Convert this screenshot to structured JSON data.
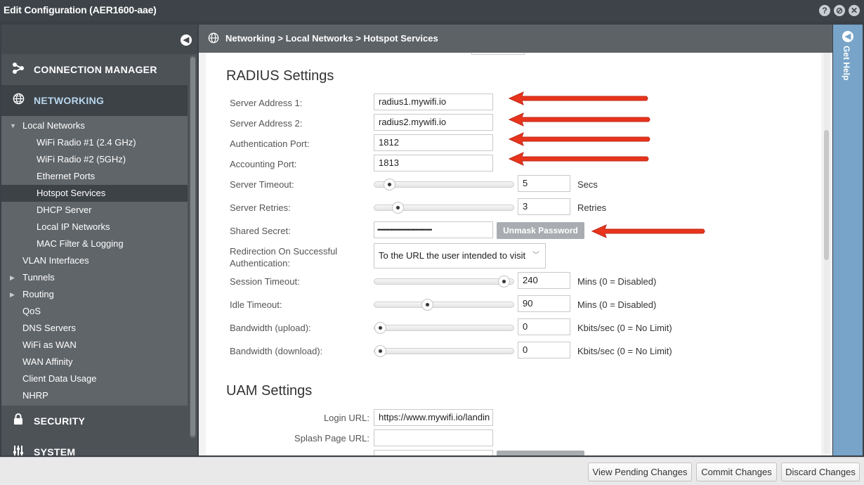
{
  "window": {
    "title": "Edit Configuration (AER1600-aae)",
    "buttons": [
      "?",
      "⊘",
      "✕"
    ]
  },
  "sidebar": {
    "collapse_icon": "chevron-left-icon",
    "sections": {
      "connection_manager": "CONNECTION MANAGER",
      "networking": "NETWORKING",
      "security": "SECURITY",
      "system": "SYSTEM"
    },
    "items": [
      {
        "label": "Local Networks",
        "level": 1,
        "caret": "▼"
      },
      {
        "label": "WiFi Radio #1 (2.4 GHz)",
        "level": 2
      },
      {
        "label": "WiFi Radio #2 (5GHz)",
        "level": 2
      },
      {
        "label": "Ethernet Ports",
        "level": 2
      },
      {
        "label": "Hotspot Services",
        "level": 2,
        "selected": true
      },
      {
        "label": "DHCP Server",
        "level": 2
      },
      {
        "label": "Local IP Networks",
        "level": 2
      },
      {
        "label": "MAC Filter & Logging",
        "level": 2
      },
      {
        "label": "VLAN Interfaces",
        "level": 1
      },
      {
        "label": "Tunnels",
        "level": 1,
        "caret": "▶"
      },
      {
        "label": "Routing",
        "level": 1,
        "caret": "▶"
      },
      {
        "label": "QoS",
        "level": 1
      },
      {
        "label": "DNS Servers",
        "level": 1
      },
      {
        "label": "WiFi as WAN",
        "level": 1
      },
      {
        "label": "WAN Affinity",
        "level": 1
      },
      {
        "label": "Client Data Usage",
        "level": 1
      },
      {
        "label": "NHRP",
        "level": 1
      }
    ]
  },
  "breadcrumb": "Networking > Local Networks > Hotspot Services",
  "radius": {
    "heading": "RADIUS Settings",
    "server_address_1": {
      "label": "Server Address 1:",
      "value": "radius1.mywifi.io"
    },
    "server_address_2": {
      "label": "Server Address 2:",
      "value": "radius2.mywifi.io"
    },
    "auth_port": {
      "label": "Authentication Port:",
      "value": "1812"
    },
    "acct_port": {
      "label": "Accounting Port:",
      "value": "1813"
    },
    "server_timeout": {
      "label": "Server Timeout:",
      "value": "5",
      "unit": "Secs",
      "level": 0.07
    },
    "server_retries": {
      "label": "Server Retries:",
      "value": "3",
      "unit": "Retries",
      "level": 0.14
    },
    "shared_secret": {
      "label": "Shared Secret:",
      "value": "••••••••••••••••••••••••••••••••••••",
      "button": "Unmask Password"
    },
    "redirection": {
      "label_line1": "Redirection On Successful",
      "label_line2": "Authentication:",
      "value": "To the URL the user intended to visit"
    },
    "session_timeout": {
      "label": "Session Timeout:",
      "value": "240",
      "unit": "Mins (0 = Disabled)",
      "level": 0.97
    },
    "idle_timeout": {
      "label": "Idle Timeout:",
      "value": "90",
      "unit": "Mins (0 = Disabled)",
      "level": 0.37
    },
    "bw_upload": {
      "label": "Bandwidth (upload):",
      "value": "0",
      "unit": "Kbits/sec (0 = No Limit)",
      "level": 0.0
    },
    "bw_download": {
      "label": "Bandwidth (download):",
      "value": "0",
      "unit": "Kbits/sec (0 = No Limit)",
      "level": 0.0
    }
  },
  "uam": {
    "heading": "UAM Settings",
    "login_url": {
      "label": "Login URL:",
      "value": "https://www.mywifi.io/landin"
    },
    "splash_url": {
      "label": "Splash Page URL:",
      "value": ""
    }
  },
  "help": {
    "label": "Get Help"
  },
  "footer": {
    "view_pending": "View Pending Changes",
    "commit": "Commit Changes",
    "discard": "Discard Changes"
  },
  "colors": {
    "arrow": "#e8341c",
    "accent": "#77a4c8"
  }
}
